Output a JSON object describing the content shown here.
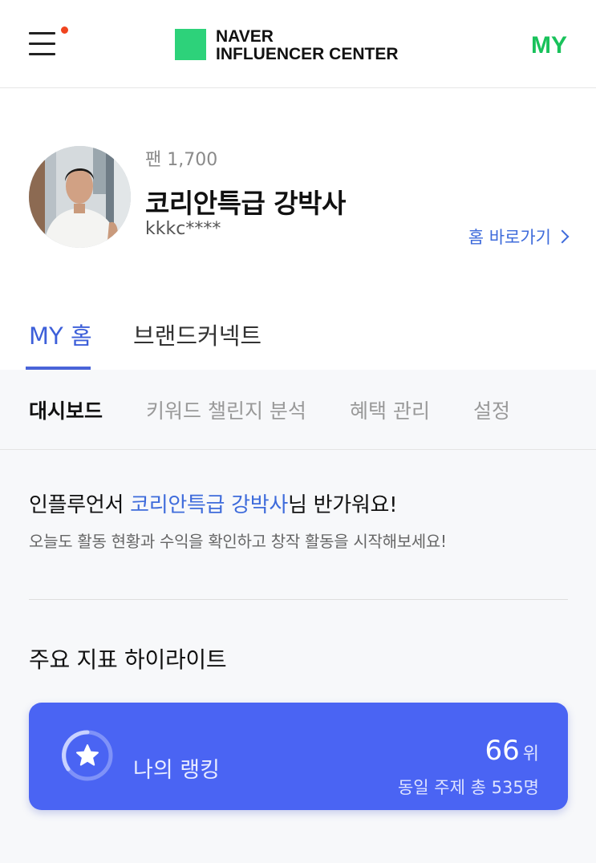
{
  "header": {
    "logo_line1": "NAVER",
    "logo_line2": "INFLUENCER CENTER",
    "my_label": "MY",
    "brand_color": "#2dd27a",
    "my_color": "#19c25b",
    "menu_icon": "hamburger-menu-icon",
    "notification_dot_color": "#f0441f"
  },
  "profile": {
    "fans": "팬 1,700",
    "name": "코리안특급 강박사",
    "id": "kkkc****",
    "home_link": "홈 바로가기"
  },
  "tabs": [
    {
      "label": "MY 홈",
      "active": true
    },
    {
      "label": "브랜드커넥트",
      "active": false
    }
  ],
  "subnav": [
    {
      "label": "대시보드",
      "active": true
    },
    {
      "label": "키워드 챌린지 분석",
      "active": false
    },
    {
      "label": "혜택 관리",
      "active": false
    },
    {
      "label": "설정",
      "active": false
    }
  ],
  "welcome": {
    "prefix": "인플루언서 ",
    "name": "코리안특급 강박사",
    "suffix": "님 반가워요!",
    "subtitle": "오늘도 활동 현황과 수익을 확인하고 창작 활동을 시작해보세요!"
  },
  "highlight": {
    "title": "주요 지표 하이라이트",
    "card": {
      "label": "나의 랭킹",
      "rank": "66",
      "rank_unit": "위",
      "total": "동일 주제 총 535명",
      "icon": "star-icon",
      "color": "#4a64f3"
    }
  }
}
